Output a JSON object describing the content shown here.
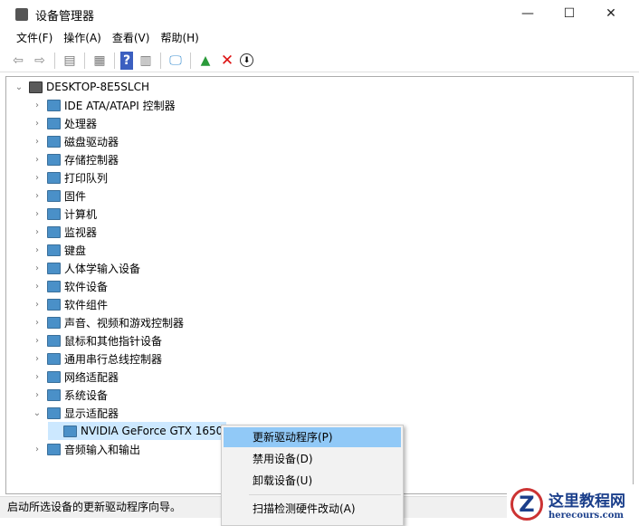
{
  "window": {
    "title": "设备管理器",
    "minimize": "—",
    "maximize": "☐",
    "close": "✕"
  },
  "menu": [
    "文件(F)",
    "操作(A)",
    "查看(V)",
    "帮助(H)"
  ],
  "toolbar": {
    "icons": [
      "back-icon",
      "forward-icon",
      "show-hide-console-tree-icon",
      "properties-icon",
      "help-icon",
      "action-pane-icon",
      "scan-hardware-icon",
      "update-driver-icon",
      "uninstall-icon",
      "disable-icon"
    ]
  },
  "tree": {
    "root": "DESKTOP-8E5SLCH",
    "items": [
      "IDE ATA/ATAPI 控制器",
      "处理器",
      "磁盘驱动器",
      "存储控制器",
      "打印队列",
      "固件",
      "计算机",
      "监视器",
      "键盘",
      "人体学输入设备",
      "软件设备",
      "软件组件",
      "声音、视频和游戏控制器",
      "鼠标和其他指针设备",
      "通用串行总线控制器",
      "网络适配器",
      "系统设备",
      "显示适配器"
    ],
    "gpu": "NVIDIA GeForce GTX 1650",
    "last": "音频输入和输出"
  },
  "context_menu": [
    "更新驱动程序(P)",
    "禁用设备(D)",
    "卸载设备(U)",
    "扫描检测硬件改动(A)"
  ],
  "status": "启动所选设备的更新驱动程序向导。",
  "watermark": {
    "title": "这里教程网",
    "url": "herecours.com"
  }
}
